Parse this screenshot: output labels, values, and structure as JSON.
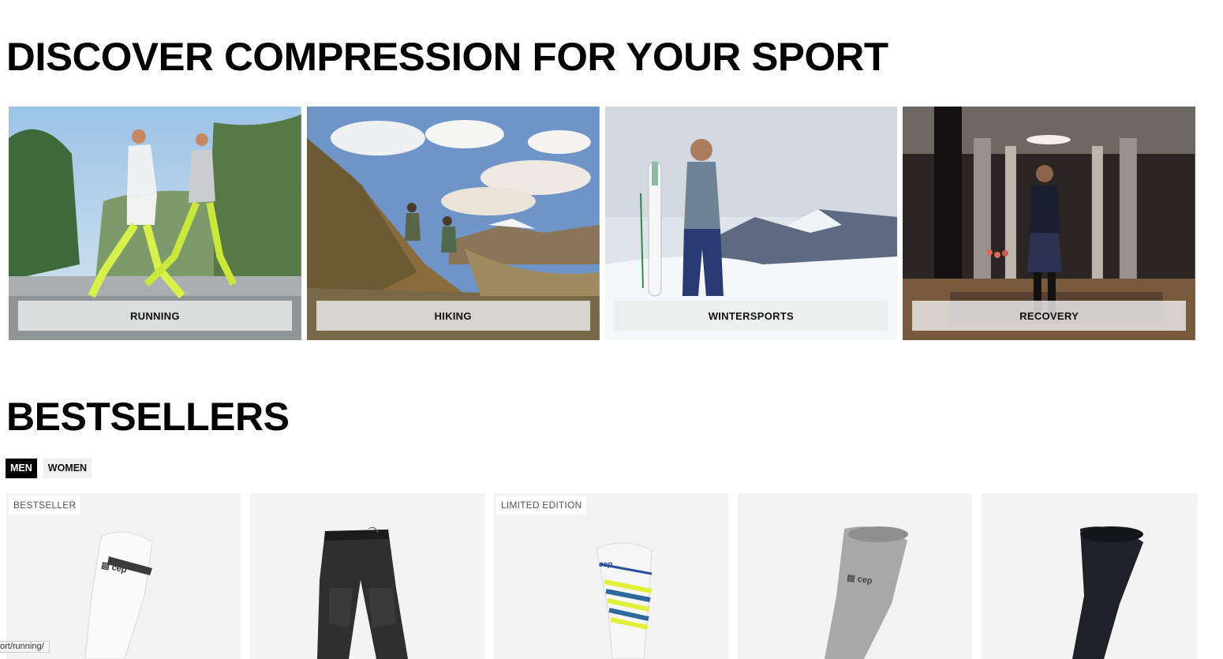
{
  "discover": {
    "title": "DISCOVER COMPRESSION FOR YOUR SPORT",
    "sports": [
      {
        "label": "RUNNING",
        "icon": "running-photo"
      },
      {
        "label": "HIKING",
        "icon": "hiking-photo"
      },
      {
        "label": "WINTERSPORTS",
        "icon": "wintersports-photo"
      },
      {
        "label": "RECOVERY",
        "icon": "recovery-photo"
      }
    ]
  },
  "bestsellers": {
    "title": "BESTSELLERS",
    "tabs": [
      {
        "label": "MEN",
        "active": true
      },
      {
        "label": "WOMEN",
        "active": false
      }
    ],
    "products": [
      {
        "badge": "BESTSELLER",
        "icon": "white-compression-sock"
      },
      {
        "badge": "",
        "icon": "black-compression-tights"
      },
      {
        "badge": "LIMITED EDITION",
        "icon": "striped-crew-sock"
      },
      {
        "badge": "",
        "icon": "grey-compression-sock"
      },
      {
        "badge": "",
        "icon": "black-compression-sleeve"
      }
    ]
  },
  "status_bar": {
    "url": "ort/running/"
  },
  "colors": {
    "accent": "#000000",
    "card_bg": "#f3f3f3"
  }
}
